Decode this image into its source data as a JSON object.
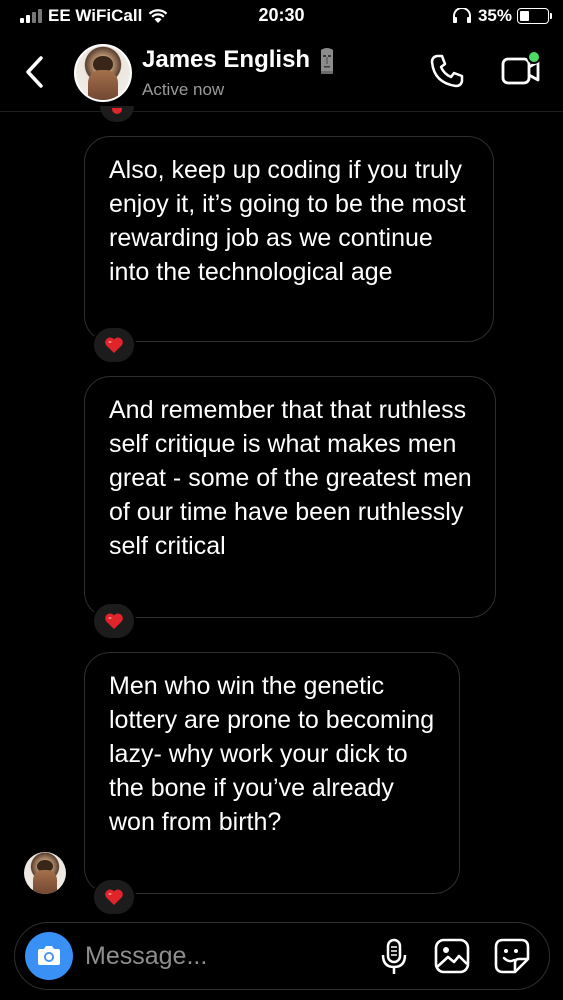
{
  "status_bar": {
    "carrier": "EE WiFiCall",
    "time": "20:30",
    "battery_percent": "35%",
    "battery_level": 0.35
  },
  "header": {
    "contact_name": "James English",
    "status": "Active now",
    "name_emoji": "moai-icon"
  },
  "messages": [
    {
      "text": "Also, keep up coding if you truly enjoy it, it’s going to be the most rewarding job as we continue into the technological age",
      "reaction": "heart-icon"
    },
    {
      "text": "And remember that that ruthless self critique is what makes men great - some of the greatest men of our time have been ruthlessly self critical",
      "reaction": "heart-icon"
    },
    {
      "text": "Men who win the genetic lottery are prone to becoming lazy- why work your dick to the bone if you’ve already won from birth?",
      "reaction": "heart-icon"
    }
  ],
  "composer": {
    "placeholder": "Message..."
  },
  "colors": {
    "background": "#000000",
    "bubble_border": "#2e2e2e",
    "camera_button": "#3a91f5",
    "heart": "#e0242c",
    "active_dot": "#4cd964",
    "secondary_text": "#9a9a9a"
  }
}
